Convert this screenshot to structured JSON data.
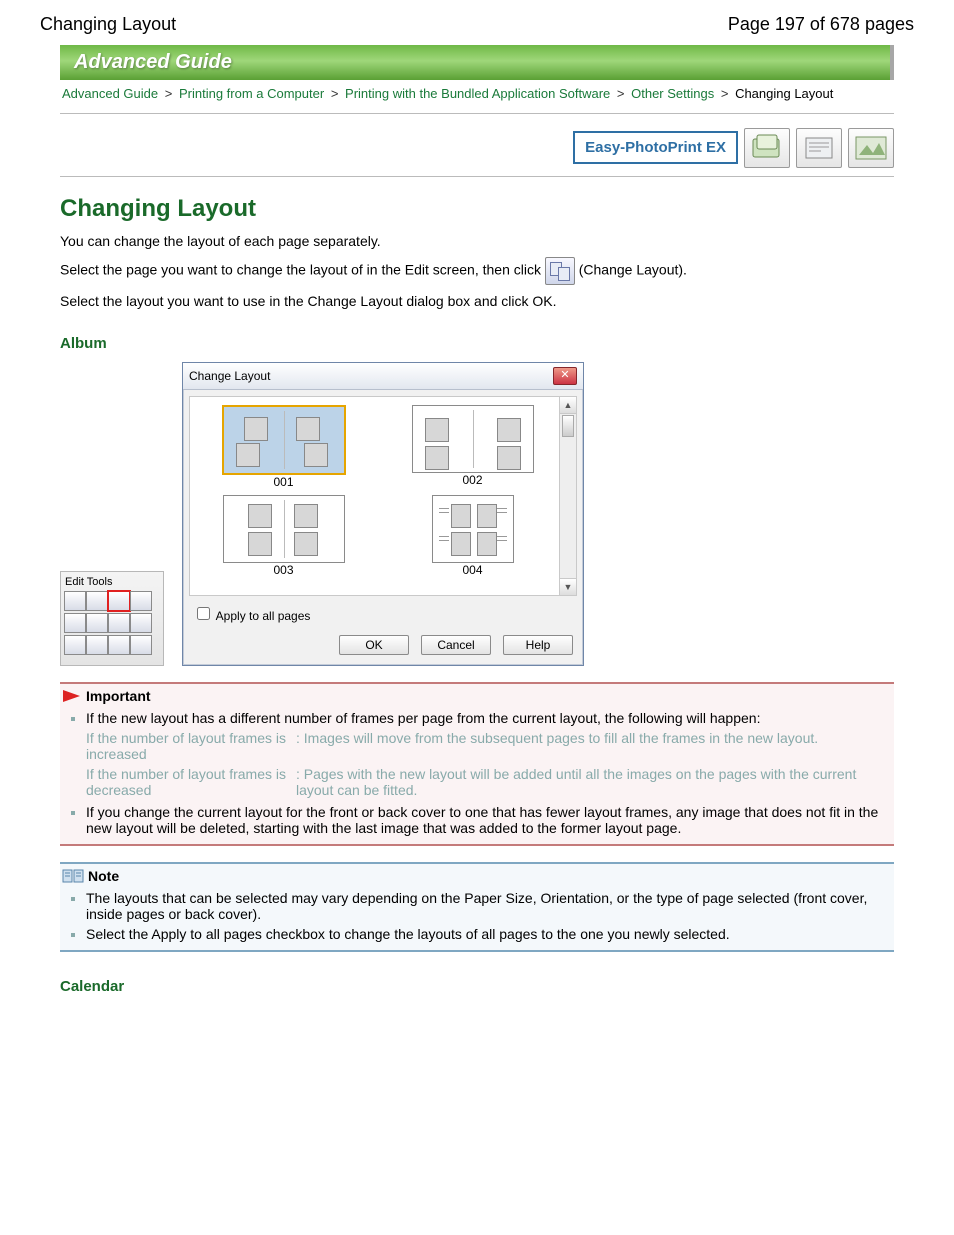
{
  "header": {
    "left": "Changing Layout",
    "right": "Page 197 of 678 pages"
  },
  "banner": "Advanced Guide",
  "breadcrumbs": {
    "items": [
      "Advanced Guide",
      "Printing from a Computer",
      "Printing with the Bundled Application Software",
      "Other Settings"
    ],
    "sep": ">",
    "current": "Changing Layout"
  },
  "appbar": {
    "name": "Easy-PhotoPrint EX"
  },
  "title": "Changing Layout",
  "intro": "You can change the layout of each page separately.",
  "p2a": "Select the page you want to change the layout of in the Edit screen, then click ",
  "p2b": " (Change Layout).",
  "p3": "Select the layout you want to use in the Change Layout dialog box and click OK.",
  "album_heading": "Album",
  "tools_caption": "Edit Tools",
  "dialog": {
    "title": "Change Layout",
    "layouts": [
      "001",
      "002",
      "003",
      "004"
    ],
    "apply_label": "Apply to all pages",
    "buttons": {
      "ok": "OK",
      "cancel": "Cancel",
      "help": "Help"
    }
  },
  "important": {
    "heading": "Important",
    "item1": "If the new layout has a different number of frames per page from the current layout, the following will happen:",
    "row1a": "If the number of layout frames is increased",
    "row1b": ": Images will move from the subsequent pages to fill all the frames in the new layout.",
    "row2a": "If the number of layout frames is decreased",
    "row2b": ": Pages with the new layout will be added until all the images on the pages with the current layout can be fitted.",
    "item2": "If you change the current layout for the front or back cover to one that has fewer layout frames, any image that does not fit in the new layout will be deleted, starting with the last image that was added to the former layout page."
  },
  "note": {
    "heading": "Note",
    "item1": "The layouts that can be selected may vary depending on the Paper Size, Orientation, or the type of page selected (front cover, inside pages or back cover).",
    "item2": "Select the Apply to all pages checkbox to change the layouts of all pages to the one you newly selected."
  },
  "calendar_heading": "Calendar"
}
